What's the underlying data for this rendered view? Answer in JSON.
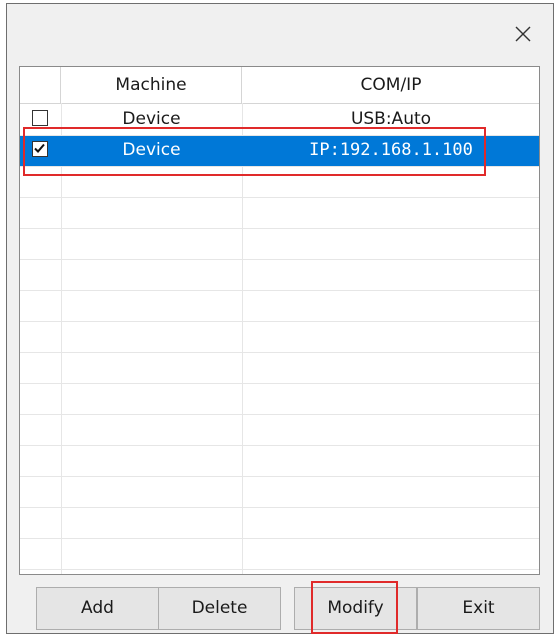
{
  "window": {
    "close_icon": "close-icon"
  },
  "list": {
    "columns": [
      "Machine",
      "COM/IP"
    ],
    "rows": [
      {
        "checked": false,
        "machine": "Device",
        "comip": "USB:Auto",
        "selected": false
      },
      {
        "checked": true,
        "machine": "Device",
        "comip": "IP:192.168.1.100",
        "selected": true
      }
    ]
  },
  "buttons": {
    "add": "Add",
    "delete": "Delete",
    "modify": "Modify",
    "exit": "Exit"
  },
  "colors": {
    "selection": "#0078d7",
    "highlight": "#e02a2a"
  }
}
